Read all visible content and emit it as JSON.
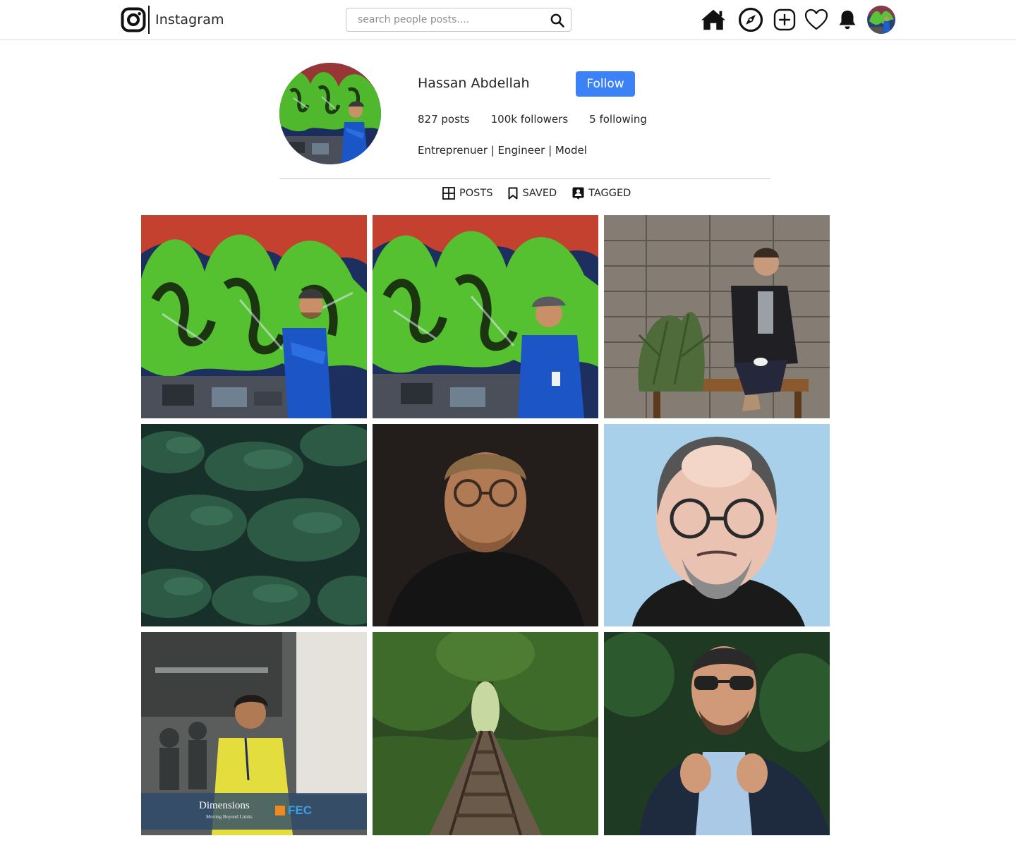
{
  "nav": {
    "brand_name": "Instagram",
    "search_placeholder": "search people posts....",
    "icons": [
      "home-icon",
      "explore-icon",
      "new-post-icon",
      "activity-heart-icon",
      "notifications-bell-icon"
    ]
  },
  "profile": {
    "name": "Hassan Abdellah",
    "follow_label": "Follow",
    "posts": "827 posts",
    "followers": "100k followers",
    "following": "5 following",
    "bio": "Entreprenuer | Engineer | Model"
  },
  "tabs": [
    {
      "label": "POSTS",
      "icon": "grid-icon"
    },
    {
      "label": "SAVED",
      "icon": "bookmark-icon"
    },
    {
      "label": "TAGGED",
      "icon": "tagged-user-icon"
    }
  ],
  "posts": [
    {
      "subject": "man in blue hoodie by graffiti wall"
    },
    {
      "subject": "man in blue hoodie looking down by graffiti wall"
    },
    {
      "subject": "man on bench by wooden wall with plant"
    },
    {
      "subject": "green evergreen foliage"
    },
    {
      "subject": "portrait of man with glasses in dark"
    },
    {
      "subject": "illustrated portrait of man with glasses"
    },
    {
      "subject": "man in yellow shirt with lanyard"
    },
    {
      "subject": "railway track through forest"
    },
    {
      "subject": "man in sunglasses adjusting collar"
    }
  ],
  "overlay": {
    "banner_text": "Dimensions",
    "banner_sub": "Moving Beyond Limits",
    "banner_logo": "FEC"
  },
  "colors": {
    "accent": "#3b82f6",
    "divider": "#c7c7c7"
  }
}
